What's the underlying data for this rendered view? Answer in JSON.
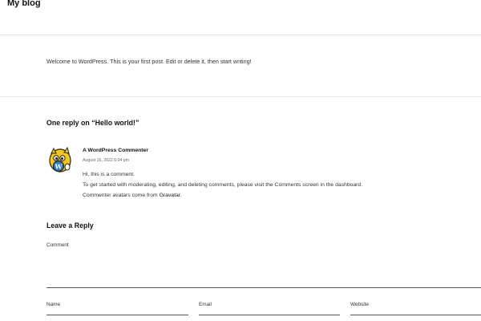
{
  "site": {
    "title": "My blog"
  },
  "post": {
    "content": "Welcome to WordPress. This is your first post. Edit or delete it, then start writing!"
  },
  "comments": {
    "title": "One reply on “Hello world!”",
    "items": [
      {
        "author": "A WordPress Commenter",
        "date": "August 16, 2022 6:04 pm",
        "line1": "Hi, this is a comment.",
        "line2": "To get started with moderating, editing, and deleting comments, please visit the Comments screen in the dashboard.",
        "line3_prefix": "Commenter avatars come from ",
        "line3_link": "Gravatar",
        "line3_suffix": "."
      }
    ]
  },
  "reply": {
    "title": "Leave a Reply",
    "comment_label": "Comment",
    "comment_value": "",
    "name_label": "Name",
    "name_value": "",
    "email_label": "Email",
    "email_value": "",
    "website_label": "Website",
    "website_value": ""
  }
}
